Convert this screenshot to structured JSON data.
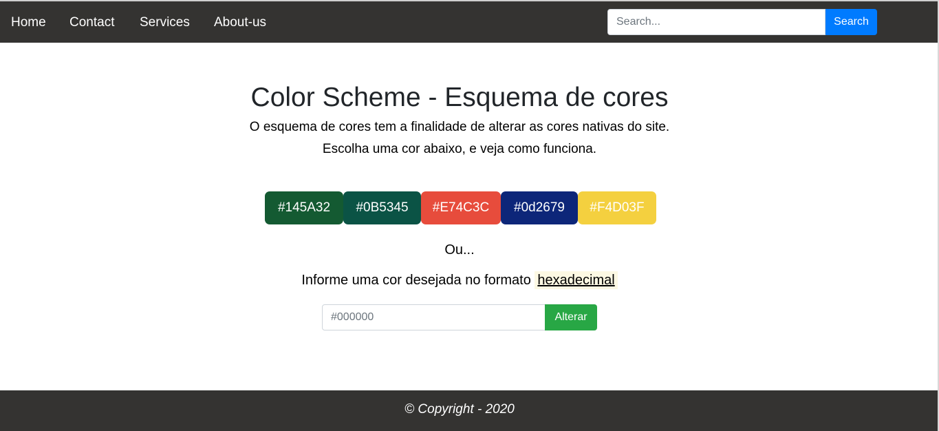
{
  "nav": {
    "items": [
      {
        "label": "Home"
      },
      {
        "label": "Contact"
      },
      {
        "label": "Services"
      },
      {
        "label": "About-us"
      }
    ],
    "search": {
      "placeholder": "Search...",
      "value": "",
      "button_label": "Search"
    }
  },
  "main": {
    "title": "Color Scheme - Esquema de cores",
    "intro_line1": "O esquema de cores tem a finalidade de alterar as cores nativas do site.",
    "intro_line2": "Escolha uma cor abaixo, e veja como funciona.",
    "swatches": [
      {
        "label": "#145A32",
        "color": "#145A32"
      },
      {
        "label": "#0B5345",
        "color": "#0B5345"
      },
      {
        "label": "#E74C3C",
        "color": "#E74C3C"
      },
      {
        "label": "#0d2679",
        "color": "#0d2679"
      },
      {
        "label": "#F4D03F",
        "color": "#F4D03F"
      }
    ],
    "or_text": "Ou...",
    "hex_prompt": "Informe uma cor desejada no formato",
    "hex_word": "hexadecimal",
    "hex_input": {
      "placeholder": "#000000",
      "value": ""
    },
    "apply_label": "Alterar"
  },
  "footer": {
    "copyright": "© Copyright - 2020"
  },
  "colors": {
    "navbar": "#343331",
    "primary": "#007bff",
    "success": "#28a745"
  }
}
